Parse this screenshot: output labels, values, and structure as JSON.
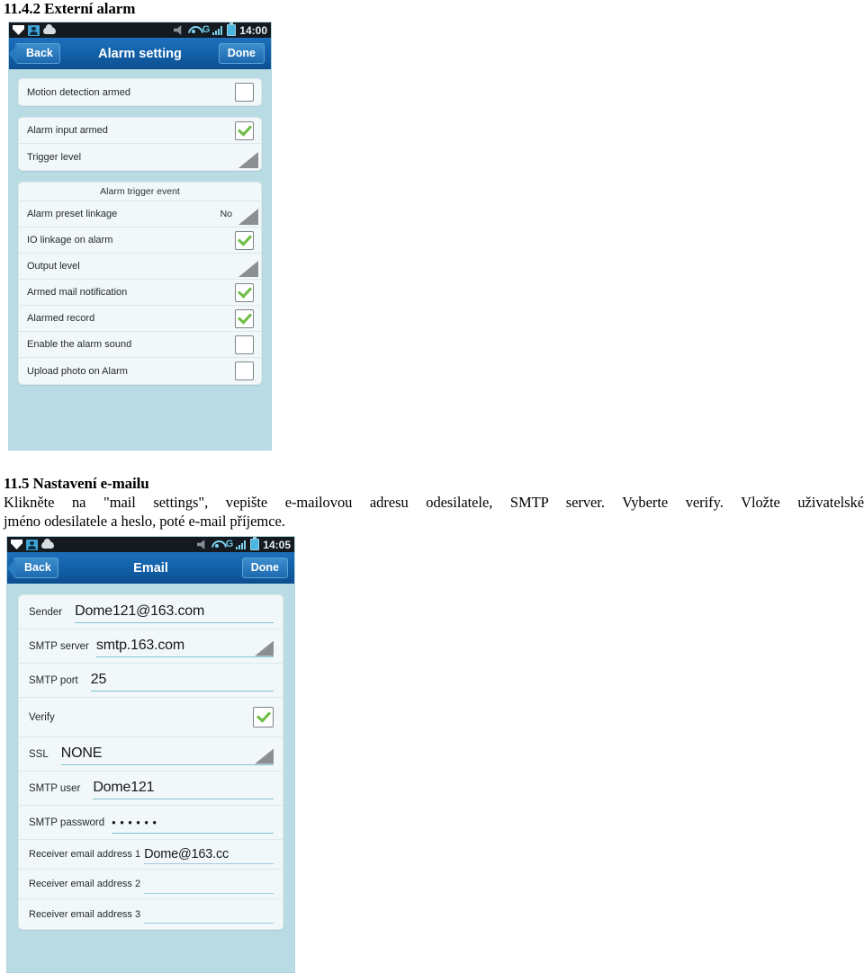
{
  "document": {
    "heading_1142": "11.4.2 Externí alarm",
    "heading_115": "11.5 Nastavení e-mailu",
    "paragraph_line1": "Klikněte na \"mail settings\", vepište e-mailovou adresu odesilatele, SMTP server. Vyberte verify. Vložte uživatelské",
    "paragraph_line2": "jméno odesilatele a heslo, poté e-mail příjemce."
  },
  "alarm_screen": {
    "statusbar": {
      "icons_left": [
        "chevron-down-icon",
        "contact-icon",
        "cloud-icon"
      ],
      "icons_right": [
        "mute-icon",
        "wifi-icon",
        "signal-icon",
        "battery-icon"
      ],
      "network_label": "G",
      "clock": "14:00"
    },
    "titlebar": {
      "back_label": "Back",
      "title": "Alarm setting",
      "done_label": "Done"
    },
    "group1": {
      "rows": [
        {
          "label": "Motion detection armed",
          "control": "checkbox",
          "checked": false
        }
      ]
    },
    "group2": {
      "rows": [
        {
          "label": "Alarm input armed",
          "control": "checkbox",
          "checked": true
        },
        {
          "label": "Trigger level",
          "control": "disclosure"
        }
      ]
    },
    "group3": {
      "header": "Alarm trigger event",
      "rows": [
        {
          "label": "Alarm preset linkage",
          "value": "No",
          "control": "disclosure"
        },
        {
          "label": "IO linkage on alarm",
          "control": "checkbox",
          "checked": true
        },
        {
          "label": "Output level",
          "control": "disclosure"
        },
        {
          "label": "Armed mail notification",
          "control": "checkbox",
          "checked": true
        },
        {
          "label": "Alarmed record",
          "control": "checkbox",
          "checked": true
        },
        {
          "label": "Enable the alarm sound",
          "control": "checkbox",
          "checked": false
        },
        {
          "label": "Upload photo on Alarm",
          "control": "checkbox",
          "checked": false
        }
      ]
    }
  },
  "email_screen": {
    "statusbar": {
      "network_label": "G",
      "clock": "14:05"
    },
    "titlebar": {
      "back_label": "Back",
      "title": "Email",
      "done_label": "Done"
    },
    "fields": [
      {
        "label": "Sender",
        "value": "Dome121@163.com",
        "control": "text"
      },
      {
        "label": "SMTP server",
        "value": "smtp.163.com",
        "control": "dropdown"
      },
      {
        "label": "SMTP port",
        "value": "25",
        "control": "text"
      },
      {
        "label": "Verify",
        "value": "",
        "control": "checkbox",
        "checked": true
      },
      {
        "label": "SSL",
        "value": "NONE",
        "control": "dropdown"
      },
      {
        "label": "SMTP user",
        "value": "Dome121",
        "control": "text"
      },
      {
        "label": "SMTP password",
        "value": "••••••",
        "control": "password"
      },
      {
        "label": "Receiver email address 1",
        "value": "Dome@163.cc",
        "control": "text"
      },
      {
        "label": "Receiver email address 2",
        "value": "",
        "control": "text"
      },
      {
        "label": "Receiver email address 3",
        "value": "",
        "control": "text"
      }
    ]
  },
  "colors": {
    "titlebar_blue": "#1362ab",
    "statusbar_dark": "#141a20",
    "screen_bg": "#b9dbe4",
    "group_bg": "#f2f8fa",
    "check_green": "#6dbe45",
    "underline_teal": "#7fc4d6",
    "triangle_gray": "#8b8f92"
  }
}
